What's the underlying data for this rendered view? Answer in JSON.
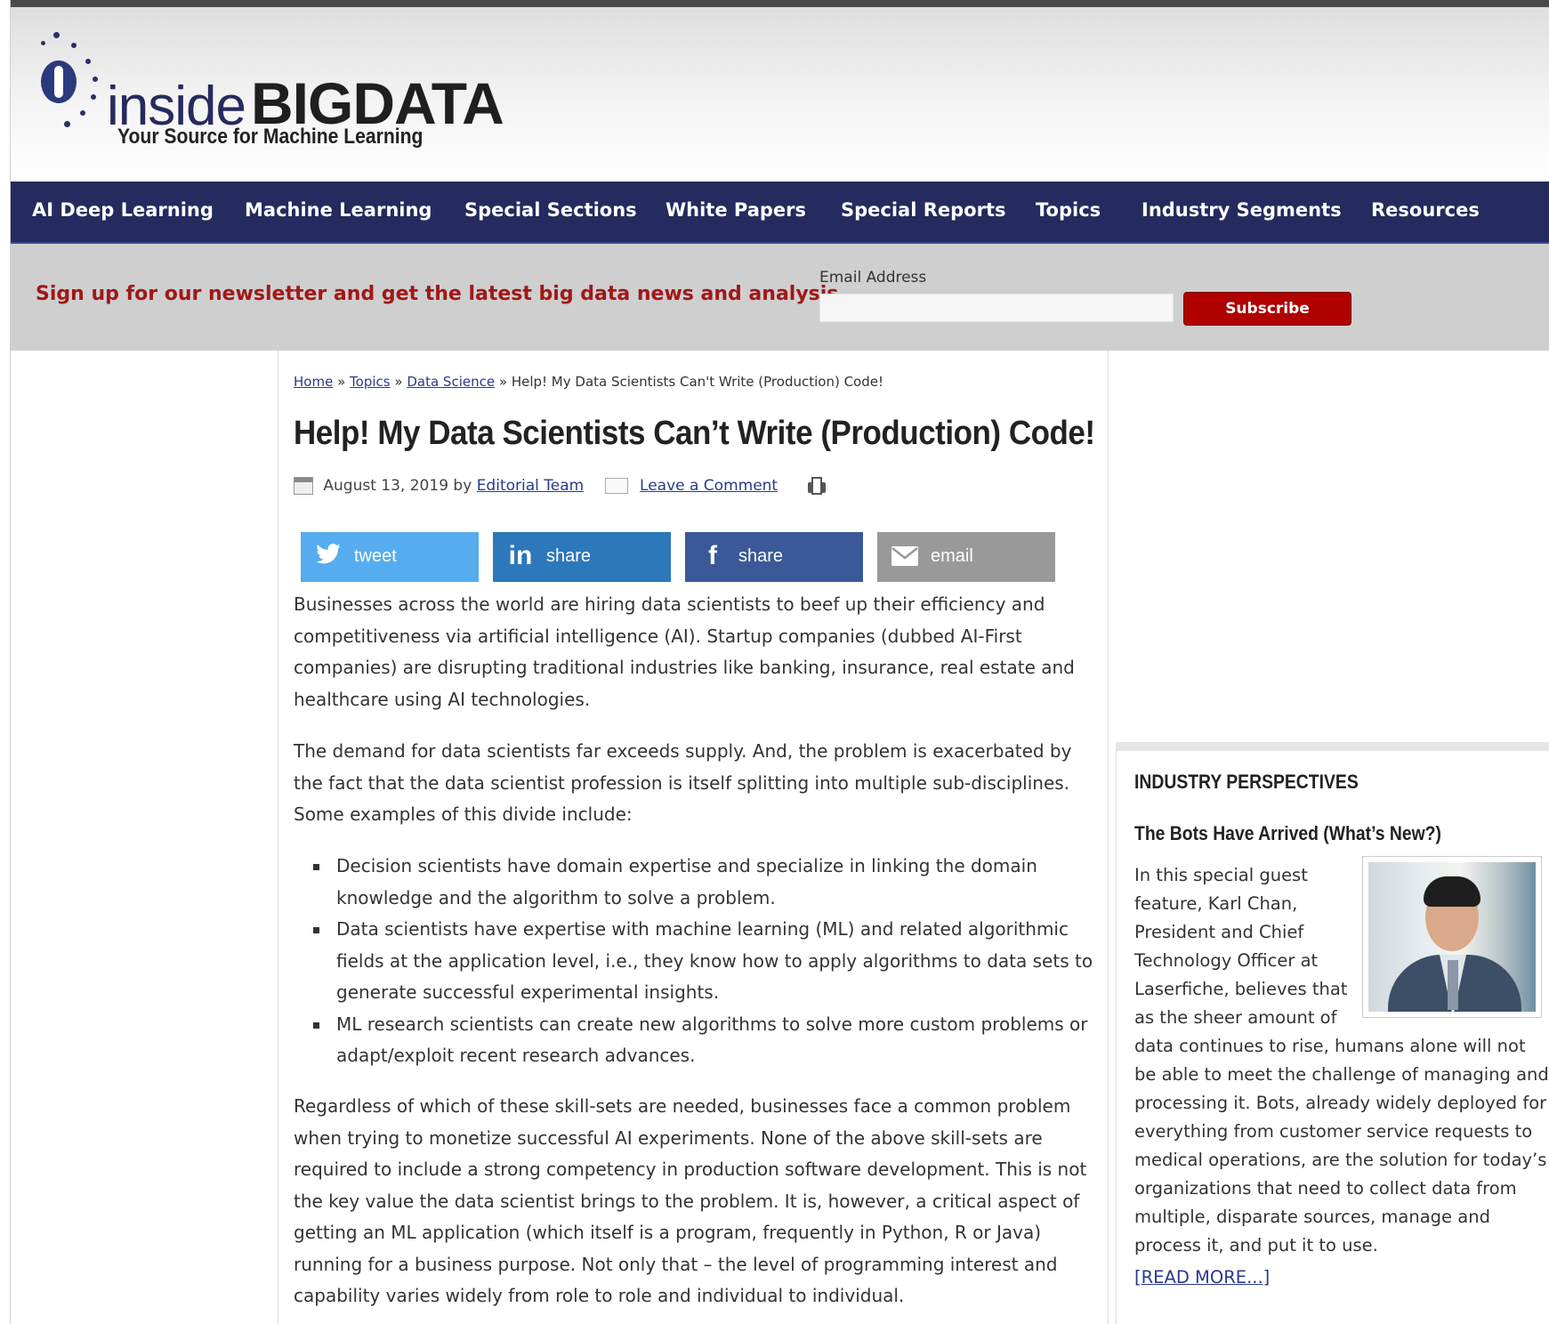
{
  "header": {
    "logo_inside": "inside",
    "logo_big": "BIGDATA",
    "tagline": "Your Source for Machine Learning"
  },
  "nav": {
    "items": [
      {
        "label": "AI Deep Learning"
      },
      {
        "label": "Machine Learning"
      },
      {
        "label": "Special Sections"
      },
      {
        "label": "White Papers"
      },
      {
        "label": "Special Reports"
      },
      {
        "label": "Topics"
      },
      {
        "label": "Industry Segments"
      },
      {
        "label": "Resources"
      }
    ]
  },
  "newsletter": {
    "text": "Sign up for our newsletter and get the latest big data news and analysis.",
    "email_label": "Email Address",
    "email_value": "",
    "subscribe_label": "Subscribe"
  },
  "breadcrumb": {
    "home": "Home",
    "topics": "Topics",
    "data_science": "Data Science",
    "current": "Help! My Data Scientists Can't Write (Production) Code!",
    "separator": "»"
  },
  "article": {
    "title": "Help! My Data Scientists Can’t Write (Production) Code!",
    "date": "August 13, 2019",
    "by": "by",
    "author": "Editorial Team",
    "comment_link": "Leave a Comment",
    "share": {
      "tweet": "tweet",
      "linkedin": "share",
      "facebook": "share",
      "email": "email"
    },
    "paragraphs": [
      "Businesses across the world are hiring data scientists to beef up their efficiency and competitiveness via artificial intelligence (AI). Startup companies (dubbed AI-First companies) are disrupting traditional industries like banking, insurance, real estate and healthcare using AI technologies.",
      "The demand for data scientists far exceeds supply. And, the problem is exacerbated by the fact that the data scientist profession is itself splitting into multiple sub-disciplines. Some examples of this divide include:",
      "Regardless of which of these skill-sets are needed, businesses face a common problem when trying to monetize successful AI experiments. None of the above skill-sets are required to include a strong competency in production software development. This is not the key value the data scientist brings to the problem. It is, however, a critical aspect of getting an ML application (which itself is a program, frequently in Python, R or Java) running for a business purpose. Not only that – the level of programming interest and capability varies widely from role to role and individual to individual."
    ],
    "bullets": [
      "Decision scientists have domain expertise and specialize in linking the domain knowledge and the algorithm to solve a problem.",
      "Data scientists have expertise with machine learning (ML) and related algorithmic fields at the application level, i.e., they know how to apply algorithms to data sets to generate successful experimental insights.",
      "ML research scientists can create new algorithms to solve more custom problems or adapt/exploit recent research advances."
    ]
  },
  "sidebar": {
    "heading": "INDUSTRY PERSPECTIVES",
    "subtitle": "The Bots Have Arrived (What’s New?)",
    "body": "In this special guest feature, Karl Chan, President and Chief Technology Officer at Laserfiche, believes that as the sheer amount of data continues to rise, humans alone will not be able to meet the challenge of managing and processing it. Bots, already widely deployed for everything from customer service requests to medical operations, are the solution for today’s organizations that need to collect data from multiple, disparate sources, manage and process it, and put it to use.",
    "read_more": "[READ MORE...]"
  },
  "colors": {
    "nav_bg": "#252b5e",
    "newsletter_text": "#a01818",
    "subscribe_bg": "#b00000",
    "twitter": "#55acee",
    "linkedin": "#2d77bb",
    "facebook": "#3b5998",
    "email": "#999999",
    "link": "#2a3a8c"
  },
  "icons": {
    "calendar": "calendar-icon",
    "comment": "comment-icon",
    "print": "print-icon",
    "twitter": "twitter-icon",
    "linkedin": "linkedin-icon",
    "facebook": "facebook-icon",
    "email": "envelope-icon"
  }
}
